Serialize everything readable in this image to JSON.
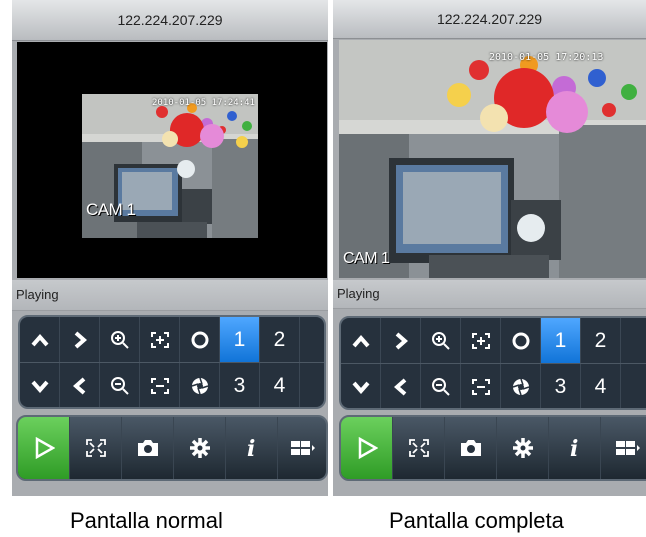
{
  "left": {
    "ip": "122.224.207.229",
    "timestamp": "2010-01-05 17:24:41",
    "cam_label": "CAM 1",
    "status": "Playing",
    "ptz_numbers": [
      "1",
      "2",
      "3",
      "4"
    ],
    "selected_channel": "1",
    "caption": "Pantalla normal"
  },
  "right": {
    "ip": "122.224.207.229",
    "timestamp": "2010-01-05 17:20:13",
    "cam_label": "CAM 1",
    "status": "Playing",
    "ptz_numbers": [
      "1",
      "2",
      "3",
      "4"
    ],
    "selected_channel": "1",
    "caption": "Pantalla completa"
  },
  "icons": {
    "ptz_row1": [
      "arrow-up-icon",
      "arrow-right-icon",
      "zoom-in-icon",
      "focus-in-icon",
      "iris-open-icon"
    ],
    "ptz_row2": [
      "arrow-down-icon",
      "arrow-left-icon",
      "zoom-out-icon",
      "focus-out-icon",
      "iris-close-icon"
    ],
    "toolbar": [
      "play-icon",
      "fullscreen-icon",
      "camera-icon",
      "gear-icon",
      "info-icon",
      "multiview-icon"
    ]
  },
  "colors": {
    "selected": "#1a84f0",
    "play_green": "#3bb030",
    "panel_dark": "#26313d"
  }
}
